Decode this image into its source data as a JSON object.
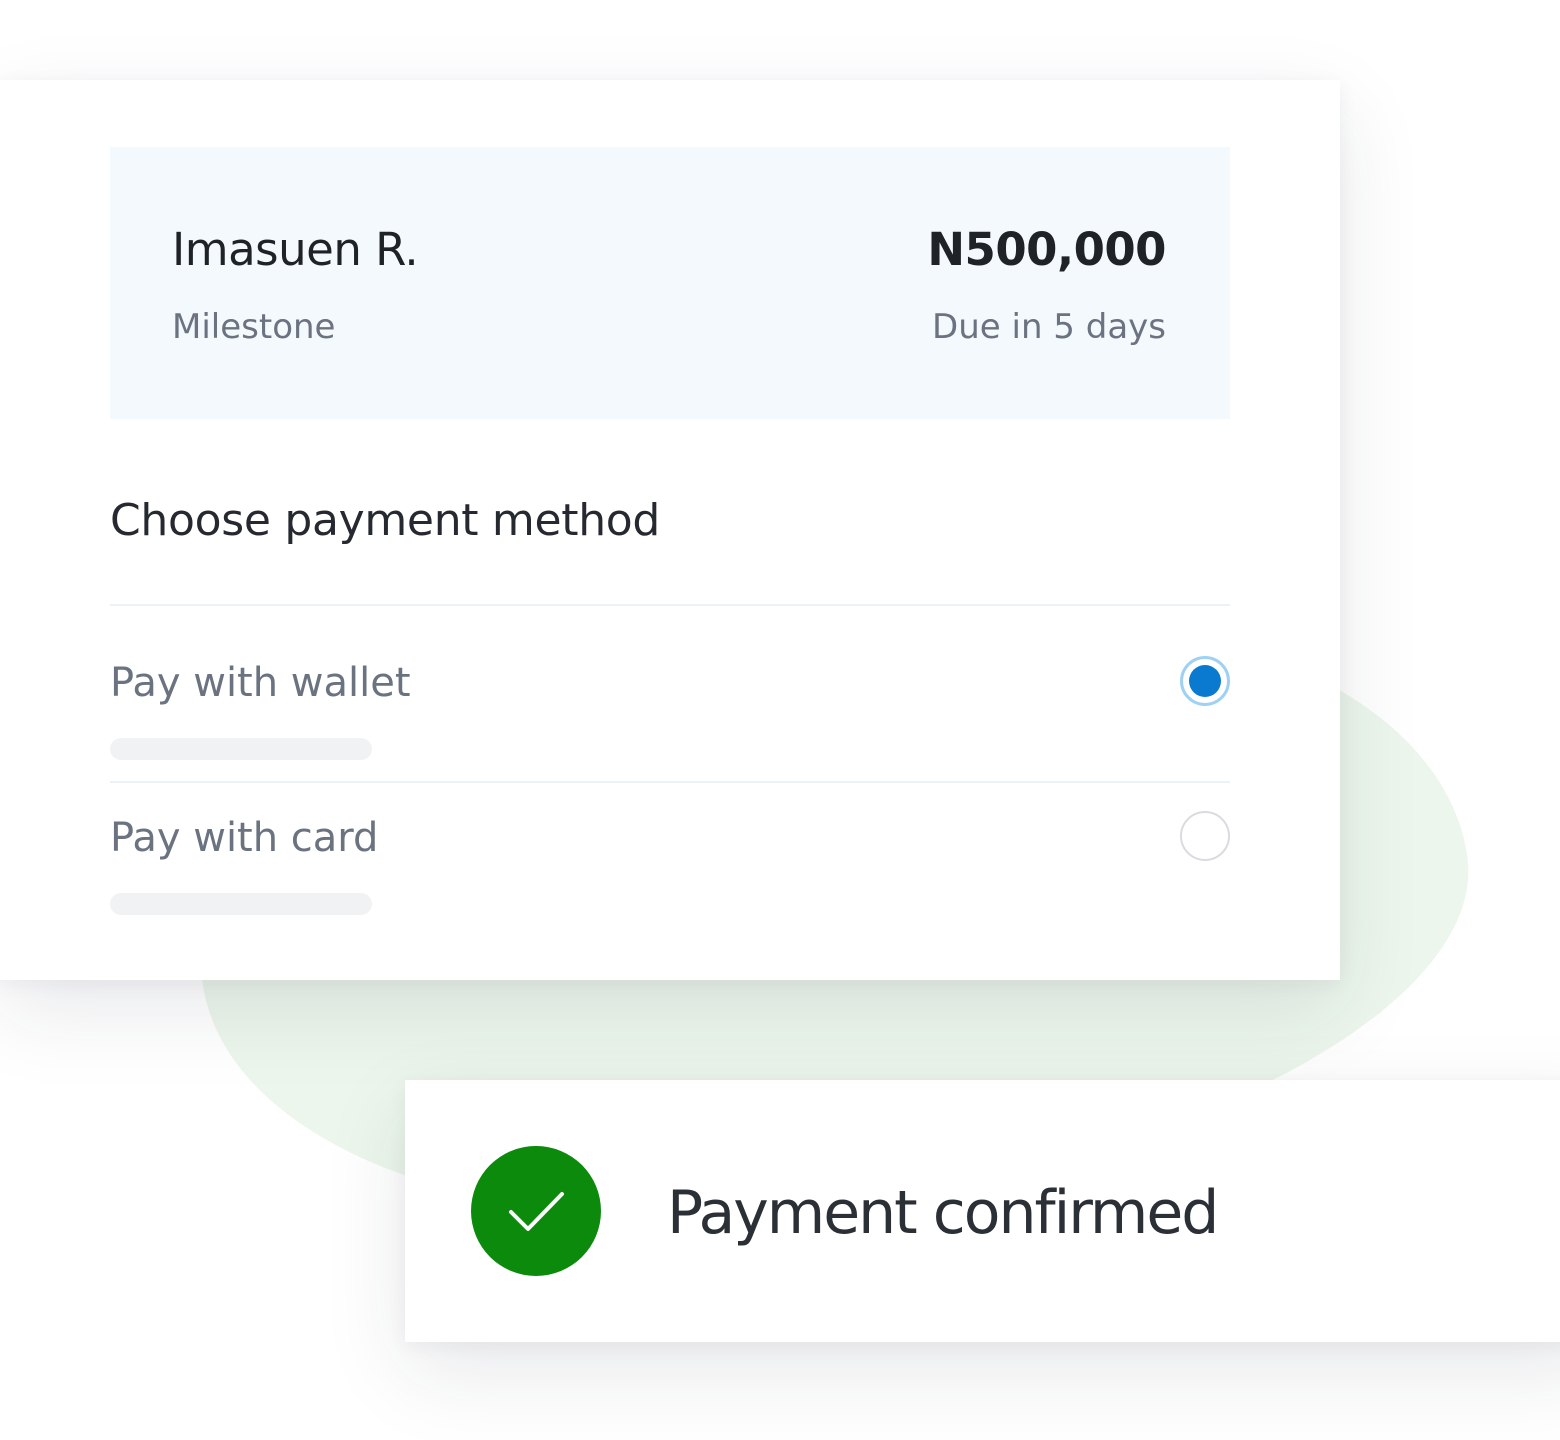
{
  "payment_summary": {
    "payee_name": "Imasuen R.",
    "payee_type": "Milestone",
    "amount": "N500,000",
    "due_text": "Due in 5 days"
  },
  "payment_method": {
    "title": "Choose payment method",
    "options": [
      {
        "label": "Pay with wallet",
        "selected": true
      },
      {
        "label": "Pay with card",
        "selected": false
      }
    ]
  },
  "confirmation": {
    "text": "Payment confirmed",
    "icon": "check-icon",
    "color": "#0c8a0c"
  },
  "colors": {
    "selected_radio": "#0a7ad0",
    "summary_background": "#f4f9fe",
    "background_blob": "#eaf5ea"
  }
}
